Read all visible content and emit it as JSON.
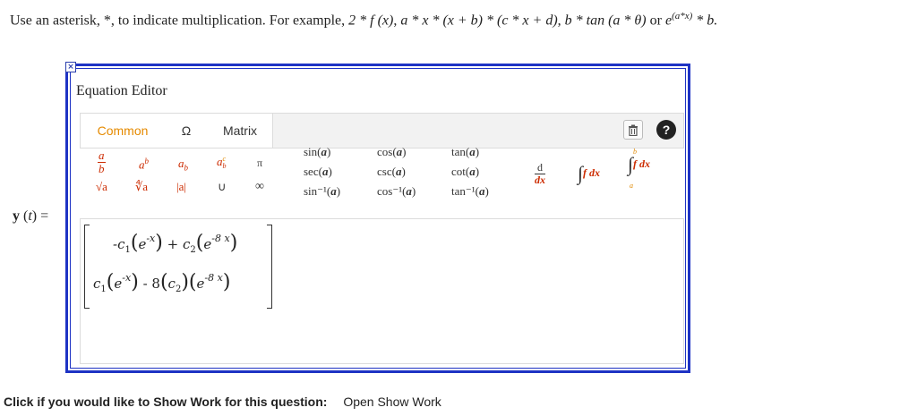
{
  "instructions": {
    "text": "Use an asterisk, *, to indicate multiplication. For example,",
    "example_1": "2 * f (x)",
    "example_2": "a * x * (x + b) * (c * x + d)",
    "example_3": "b * tan (a * θ)",
    "or": "or",
    "example_4_base": "e",
    "example_4_exp": "(a*x)",
    "example_4_tail": "* b."
  },
  "answer_label": {
    "name": "y",
    "var": "t",
    "eq": "="
  },
  "editor": {
    "close_glyph": "×",
    "title": "Equation Editor",
    "tabs": [
      "Common",
      "Ω",
      "Matrix"
    ],
    "trash_icon": "trash-icon",
    "help_icon": "help-icon",
    "help_glyph": "?",
    "palette": {
      "frac": {
        "num": "a",
        "den": "b"
      },
      "power": {
        "base": "a",
        "exp": "b"
      },
      "subscript": {
        "base": "a",
        "sub": "b"
      },
      "subsup": {
        "base": "a",
        "sup": "c",
        "sub": "b"
      },
      "pi": "π",
      "sqrt": "√a",
      "nthroot": "∜a",
      "abs": "|a|",
      "union": "∪",
      "infinity": "∞",
      "trig_col1": [
        "sin(",
        "sec(",
        "sin⁻¹("
      ],
      "trig_col2": [
        "cos(",
        "csc(",
        "cos⁻¹("
      ],
      "trig_col3": [
        "tan(",
        "cot(",
        "tan⁻¹("
      ],
      "trig_arg": "a",
      "trig_close": ")",
      "deriv_num": "d",
      "deriv_den": "dx",
      "integral": "∫",
      "integral_body": "f dx",
      "def_upper": "b",
      "def_lower": "a"
    },
    "matrix_rows": [
      {
        "coef1": "-c",
        "sub1": "1",
        "exp1": "-x",
        "op": "+",
        "coef2": "c",
        "sub2": "2",
        "exp2": "-8 x"
      },
      {
        "coef1": "c",
        "sub1": "1",
        "exp1": "-x",
        "op": "- 8",
        "coef2": "c",
        "sub2": "2",
        "exp2": "-8 x"
      }
    ],
    "base": "e"
  },
  "footer": {
    "prompt": "Click if you would like to Show Work for this question:",
    "link": "Open Show Work"
  },
  "colors": {
    "border": "#1e33c4",
    "accent": "#e58a00",
    "symbol": "#cc2b00"
  }
}
